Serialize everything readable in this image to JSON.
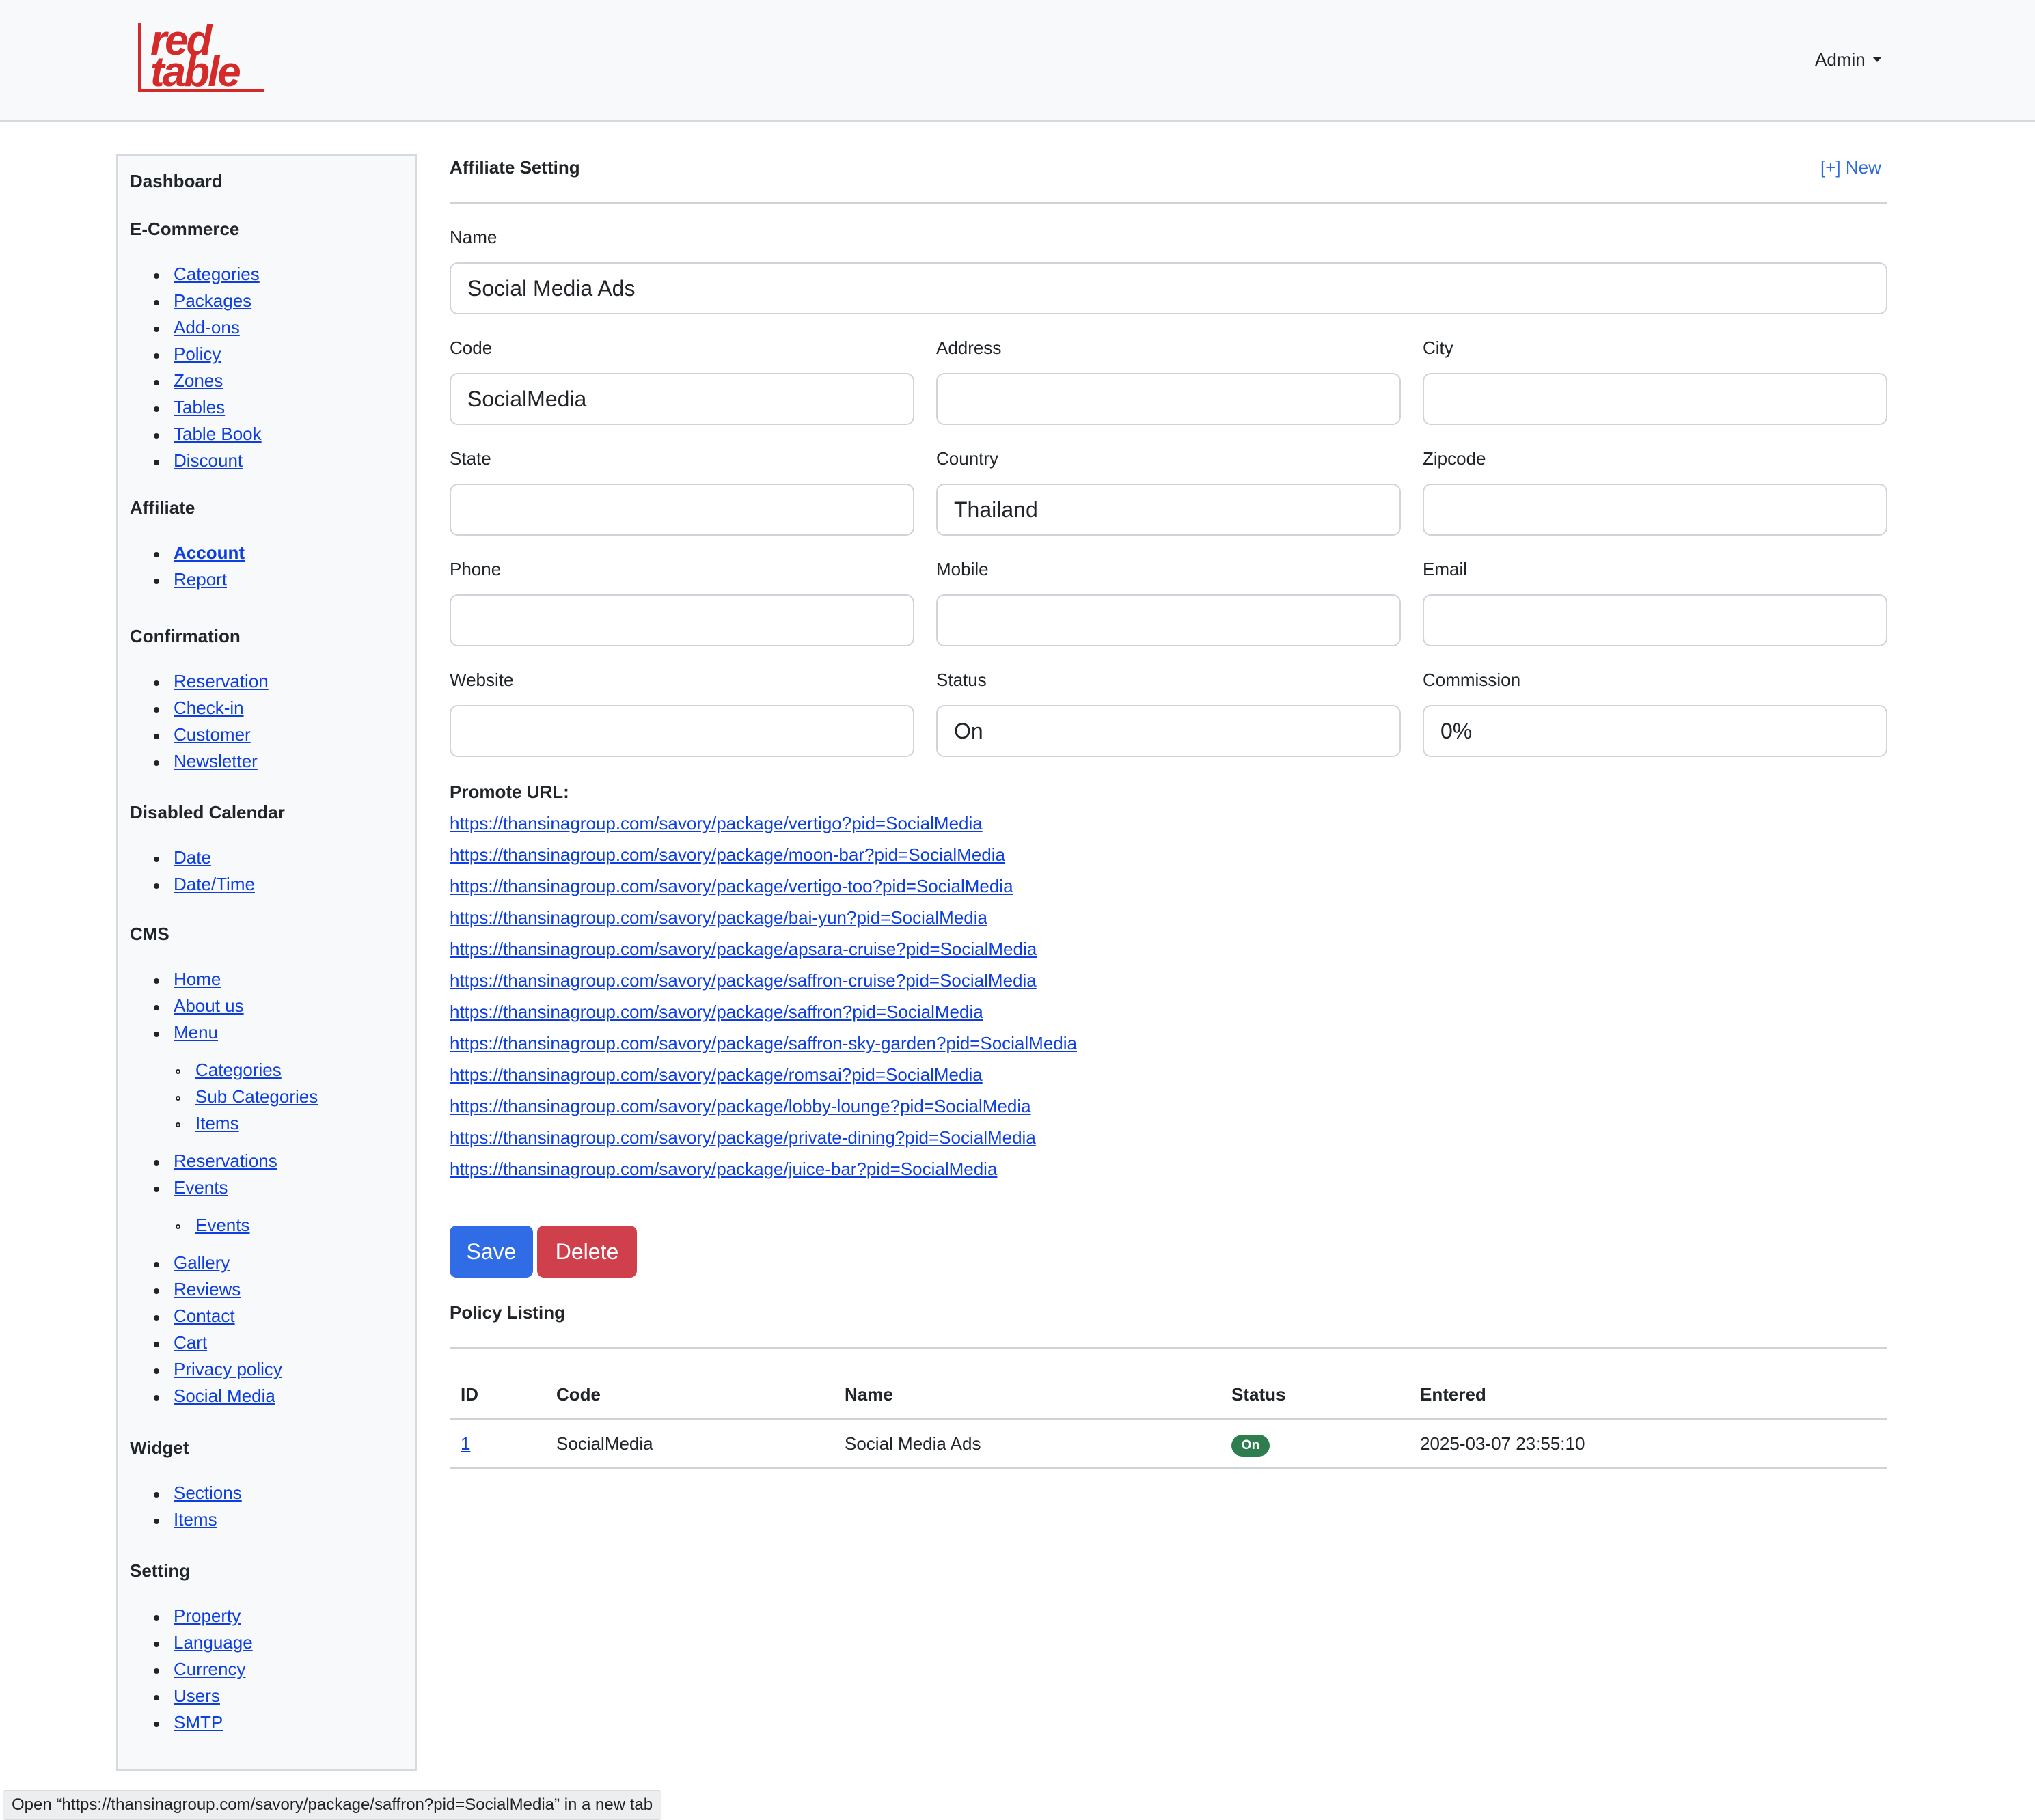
{
  "header": {
    "logo_text_1": "red",
    "logo_text_2": "table",
    "admin_label": "Admin"
  },
  "sidebar": {
    "dashboard": "Dashboard",
    "ecommerce": {
      "title": "E-Commerce",
      "items": [
        "Categories",
        "Packages",
        "Add-ons",
        "Policy",
        "Zones",
        "Tables",
        "Table Book",
        "Discount"
      ]
    },
    "affiliate": {
      "title": "Affiliate",
      "items": [
        "Account",
        "Report"
      ]
    },
    "confirmation": {
      "title": "Confirmation",
      "items": [
        "Reservation",
        "Check-in",
        "Customer",
        "Newsletter"
      ]
    },
    "disabled_calendar": {
      "title": "Disabled Calendar",
      "items": [
        "Date",
        "Date/Time"
      ]
    },
    "cms": {
      "title": "CMS",
      "items": [
        "Home",
        "About us",
        "Menu"
      ],
      "menu_sub": [
        "Categories",
        "Sub Categories",
        "Items"
      ],
      "items2": [
        "Reservations",
        "Events"
      ],
      "events_sub": [
        "Events"
      ],
      "items3": [
        "Gallery",
        "Reviews",
        "Contact",
        "Cart",
        "Privacy policy",
        "Social Media"
      ]
    },
    "widget": {
      "title": "Widget",
      "items": [
        "Sections",
        "Items"
      ]
    },
    "setting": {
      "title": "Setting",
      "items": [
        "Property",
        "Language",
        "Currency",
        "Users",
        "SMTP"
      ]
    }
  },
  "form": {
    "title": "Affiliate Setting",
    "new_link": "[+] New",
    "name": {
      "label": "Name",
      "value": "Social Media Ads"
    },
    "code": {
      "label": "Code",
      "value": "SocialMedia"
    },
    "address": {
      "label": "Address",
      "value": ""
    },
    "city": {
      "label": "City",
      "value": ""
    },
    "state": {
      "label": "State",
      "value": ""
    },
    "country": {
      "label": "Country",
      "value": "Thailand"
    },
    "zipcode": {
      "label": "Zipcode",
      "value": ""
    },
    "phone": {
      "label": "Phone",
      "value": ""
    },
    "mobile": {
      "label": "Mobile",
      "value": ""
    },
    "email": {
      "label": "Email",
      "value": ""
    },
    "website": {
      "label": "Website",
      "value": ""
    },
    "status": {
      "label": "Status",
      "value": "On"
    },
    "commission": {
      "label": "Commission",
      "value": "0%"
    },
    "promote_label": "Promote URL:",
    "promote_urls": [
      "https://thansinagroup.com/savory/package/vertigo?pid=SocialMedia",
      "https://thansinagroup.com/savory/package/moon-bar?pid=SocialMedia",
      "https://thansinagroup.com/savory/package/vertigo-too?pid=SocialMedia",
      "https://thansinagroup.com/savory/package/bai-yun?pid=SocialMedia",
      "https://thansinagroup.com/savory/package/apsara-cruise?pid=SocialMedia",
      "https://thansinagroup.com/savory/package/saffron-cruise?pid=SocialMedia",
      "https://thansinagroup.com/savory/package/saffron?pid=SocialMedia",
      "https://thansinagroup.com/savory/package/saffron-sky-garden?pid=SocialMedia",
      "https://thansinagroup.com/savory/package/romsai?pid=SocialMedia",
      "https://thansinagroup.com/savory/package/lobby-lounge?pid=SocialMedia",
      "https://thansinagroup.com/savory/package/private-dining?pid=SocialMedia",
      "https://thansinagroup.com/savory/package/juice-bar?pid=SocialMedia"
    ],
    "save_label": "Save",
    "delete_label": "Delete"
  },
  "listing": {
    "title": "Policy Listing",
    "columns": [
      "ID",
      "Code",
      "Name",
      "Status",
      "Entered"
    ],
    "rows": [
      {
        "id": "1",
        "code": "SocialMedia",
        "name": "Social Media Ads",
        "status": "On",
        "entered": "2025-03-07 23:55:10"
      }
    ]
  },
  "statusbar": {
    "text": "Open “https://thansinagroup.com/savory/package/saffron?pid=SocialMedia” in a new tab"
  },
  "colors": {
    "brand": "#d42a2a",
    "primary": "#2f6ce5",
    "danger": "#d0404c",
    "success": "#2e7d4f",
    "link": "#0d3fe0"
  }
}
